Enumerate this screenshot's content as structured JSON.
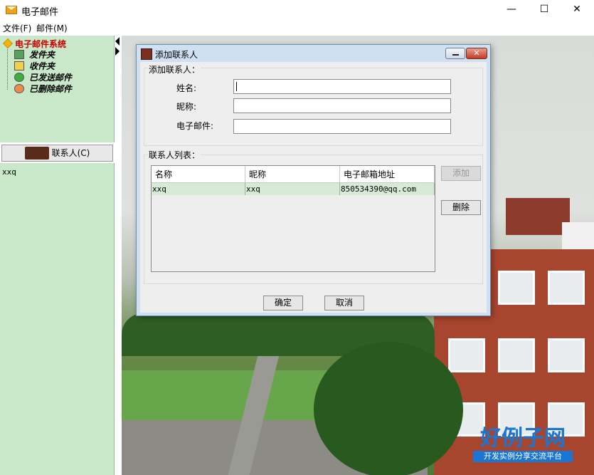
{
  "window": {
    "title": "电子邮件",
    "minimize": "—",
    "maximize": "☐",
    "close": "✕"
  },
  "menu": [
    {
      "label": "文件(F)"
    },
    {
      "label": "邮件(M)"
    }
  ],
  "tree": {
    "root": "电子邮件系统",
    "items": [
      {
        "label": "发件夹",
        "icon": "outbox-icon"
      },
      {
        "label": "收件夹",
        "icon": "inbox-folder-icon"
      },
      {
        "label": "已发送邮件",
        "icon": "sent-check-icon"
      },
      {
        "label": "已删除邮件",
        "icon": "deleted-icon"
      }
    ]
  },
  "contacts_button": {
    "label": "联系人(C)"
  },
  "contact_list": [
    "xxq"
  ],
  "dialog": {
    "title": "添加联系人",
    "add_section_title": "添加联系人：",
    "fields": {
      "name": {
        "label": "姓名:",
        "value": ""
      },
      "nickname": {
        "label": "昵称:",
        "value": ""
      },
      "email": {
        "label": "电子邮件:",
        "value": ""
      }
    },
    "list_section_title": "联系人列表：",
    "table": {
      "columns": [
        "名称",
        "昵称",
        "电子邮箱地址"
      ],
      "rows": [
        [
          "xxq",
          "xxq",
          "850534390@qq.com"
        ]
      ]
    },
    "buttons": {
      "add": "添加",
      "delete": "删除",
      "ok": "确定",
      "cancel": "取消"
    }
  },
  "watermark": {
    "big": "好例子网",
    "small": "开发实例分享交流平台"
  },
  "colors": {
    "left_panel": "#c9e7c9",
    "tree_root": "#c80000",
    "dialog_frame": "#cfe0f3",
    "watermark": "#1976d2"
  }
}
